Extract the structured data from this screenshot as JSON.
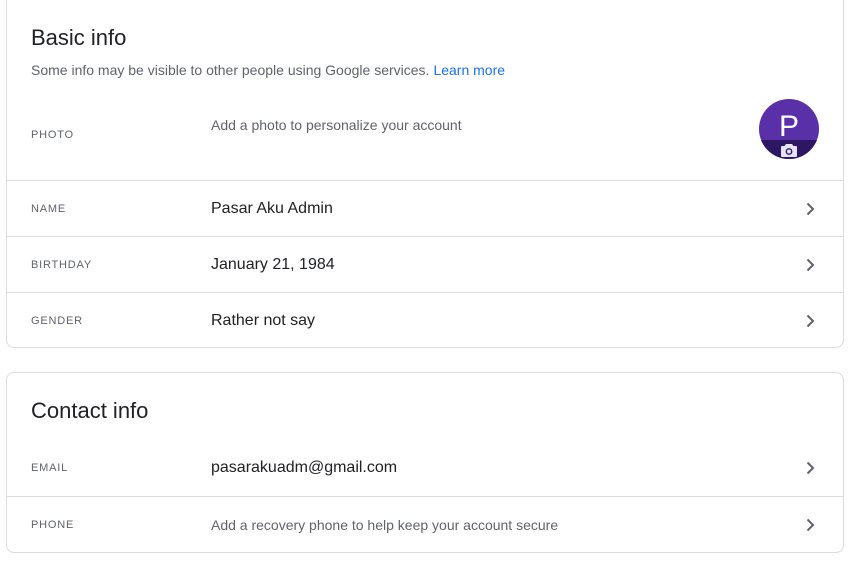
{
  "basic_info": {
    "title": "Basic info",
    "subtitle": "Some info may be visible to other people using Google services.",
    "learn_more": "Learn more",
    "photo": {
      "label": "PHOTO",
      "value": "Add a photo to personalize your account",
      "avatar_letter": "P",
      "avatar_color": "#5a30a8"
    },
    "name": {
      "label": "NAME",
      "value": "Pasar Aku Admin"
    },
    "birthday": {
      "label": "BIRTHDAY",
      "value": "January 21, 1984"
    },
    "gender": {
      "label": "GENDER",
      "value": "Rather not say"
    }
  },
  "contact_info": {
    "title": "Contact info",
    "email": {
      "label": "EMAIL",
      "value": "pasarakuadm@gmail.com"
    },
    "phone": {
      "label": "PHONE",
      "value": "Add a recovery phone to help keep your account secure"
    }
  },
  "colors": {
    "border": "#dadce0",
    "link": "#1a73e8",
    "text_primary": "#202124",
    "text_secondary": "#5f6368"
  },
  "icons": {
    "chevron": "chevron-right-icon",
    "camera": "camera-icon"
  }
}
